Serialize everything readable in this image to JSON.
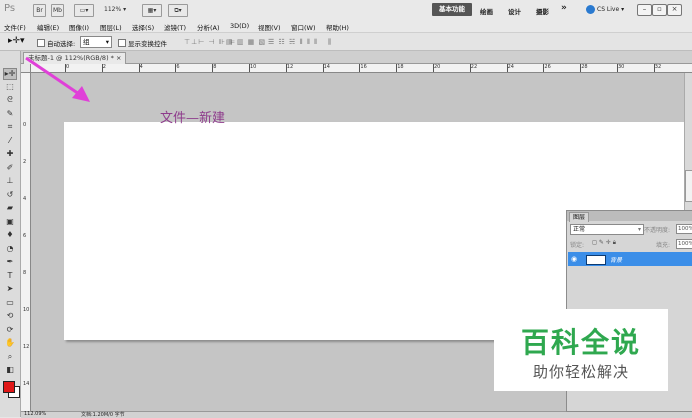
{
  "app": {
    "logo": "Ps",
    "zoom_value": "112%",
    "workspaces": [
      "基本功能",
      "绘画",
      "设计",
      "摄影"
    ],
    "more": "»",
    "cs_live": "CS Live"
  },
  "menu": [
    "文件(F)",
    "编辑(E)",
    "图像(I)",
    "图层(L)",
    "选择(S)",
    "滤镜(T)",
    "分析(A)",
    "3D(D)",
    "视图(V)",
    "窗口(W)",
    "帮助(H)"
  ],
  "options": {
    "auto_select_label": "自动选择:",
    "auto_select_value": "组",
    "show_transform_label": "显示变换控件"
  },
  "document": {
    "tab_title": "未标题-1 @ 112%(RGB/8) *",
    "tab_close": "×",
    "ruler_h": [
      "0",
      "2",
      "4",
      "6",
      "8",
      "10",
      "12",
      "14",
      "16",
      "18",
      "20",
      "22",
      "24",
      "26",
      "28",
      "30",
      "32"
    ],
    "ruler_v": [
      "0",
      "2",
      "4",
      "6",
      "8",
      "10",
      "12",
      "14"
    ],
    "status_zoom": "112.09%",
    "status_doc": "文档:1.20M/0 字节"
  },
  "annotation": {
    "text": "文件—新建",
    "color": "#8e3b8c",
    "arrow_color": "#e040d8"
  },
  "layers": {
    "tab": "图层",
    "blend_mode": "正常",
    "opacity_label": "不透明度:",
    "opacity_value": "100%",
    "lock_label": "锁定:",
    "fill_label": "填充:",
    "fill_value": "100%",
    "layer_name": "背景"
  },
  "watermark": {
    "title": "百科全说",
    "subtitle": "助你轻松解决",
    "title_color": "#2fa84f"
  },
  "colors": {
    "foreground": "#e01818",
    "background": "#ffffff",
    "active_layer": "#3b8ee8"
  }
}
